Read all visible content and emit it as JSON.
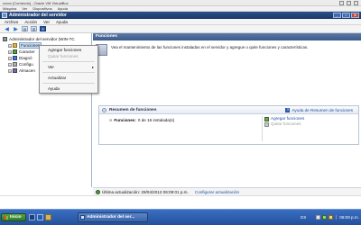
{
  "vbox": {
    "title": "xxxxx [Corriendo] - Oracle VM VirtualBox",
    "menu": [
      "Máquina",
      "Ver",
      "Dispositivos",
      "Ayuda"
    ]
  },
  "window": {
    "title": "Administrador del servidor",
    "minimize": "_",
    "maximize": "□",
    "close": "X"
  },
  "menu": [
    "Archivo",
    "Acción",
    "Ver",
    "Ayuda"
  ],
  "toolbar": {
    "back": "◀",
    "forward": "▶"
  },
  "tree": {
    "root": "Administrador del servidor (WIN-TC",
    "items": [
      "Funciones",
      "Caracter",
      "Diagnó",
      "Configu",
      "Almacen"
    ]
  },
  "context_menu": {
    "add": "Agregar funciones",
    "remove": "Quitar funciones",
    "view": "Ver",
    "refresh": "Actualizar",
    "help": "Ayuda",
    "submenu_arrow": "▸"
  },
  "content": {
    "header": "Funciones",
    "intro": "Vea el mantenimiento de las funciones instaladas en el servidor y agregue o quite funciones y características."
  },
  "summary": {
    "title": "Resumen de funciones",
    "help_link": "Ayuda de Resumen de funciones",
    "roles_label": "Funciones:",
    "roles_value": "0 de 16 instalada(s)",
    "add": "Agregar funciones",
    "remove": "Quitar funciones"
  },
  "status": {
    "last_update": "Última actualización: 29/04/2012 06:09:01 p.m.",
    "configure": "Configurar actualización"
  },
  "taskbar": {
    "start": "Inicio",
    "task": "Administrador del ser...",
    "lang": "ES",
    "clock": "06:09 p.m."
  },
  "colors": {
    "title_bar": "#1c3766",
    "taskbar": "#24509b",
    "link": "#1d4fa3"
  }
}
